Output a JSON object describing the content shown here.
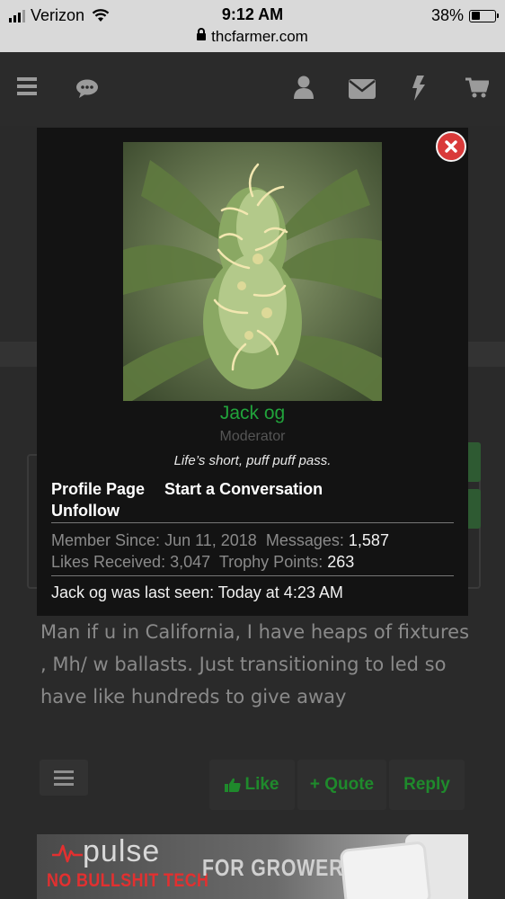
{
  "status_bar": {
    "carrier": "Verizon",
    "time": "9:12 AM",
    "url": "thcfarmer.com",
    "battery": "38%",
    "battery_level": 0.38
  },
  "navbar": {
    "icons": [
      "menu-icon",
      "chat-icon",
      "user-icon",
      "mail-icon",
      "bolt-icon",
      "cart-icon"
    ]
  },
  "popup": {
    "name": "Jack og",
    "role": "Moderator",
    "signature": "Life’s short, puff puff pass.",
    "links": {
      "profile_page": "Profile Page",
      "start_conversation": "Start a Conversation",
      "unfollow": "Unfollow"
    },
    "stats": {
      "member_since_label": "Member Since:",
      "member_since_value": "Jun 11, 2018",
      "messages_label": "Messages:",
      "messages_value": "1,587",
      "likes_label": "Likes Received:",
      "likes_value": "3,047",
      "trophy_label": "Trophy Points:",
      "trophy_value": "263"
    },
    "last_seen": "Jack og was last seen: Today at 4:23 AM"
  },
  "post": {
    "text": "Man if u in California, I have heaps of fixtures , Mh/ w ballasts. Just transitioning to led so have like hundreds to give away",
    "actions": {
      "like": "Like",
      "quote": "+ Quote",
      "reply": "Reply"
    }
  },
  "ad": {
    "logo": "pulse",
    "tagline": "NO BULLSHIT TECH",
    "headline": "FOR GROWERS"
  },
  "colors": {
    "accent_green": "#21a33b",
    "close_red": "#d93a3a",
    "ad_red": "#e23030"
  }
}
